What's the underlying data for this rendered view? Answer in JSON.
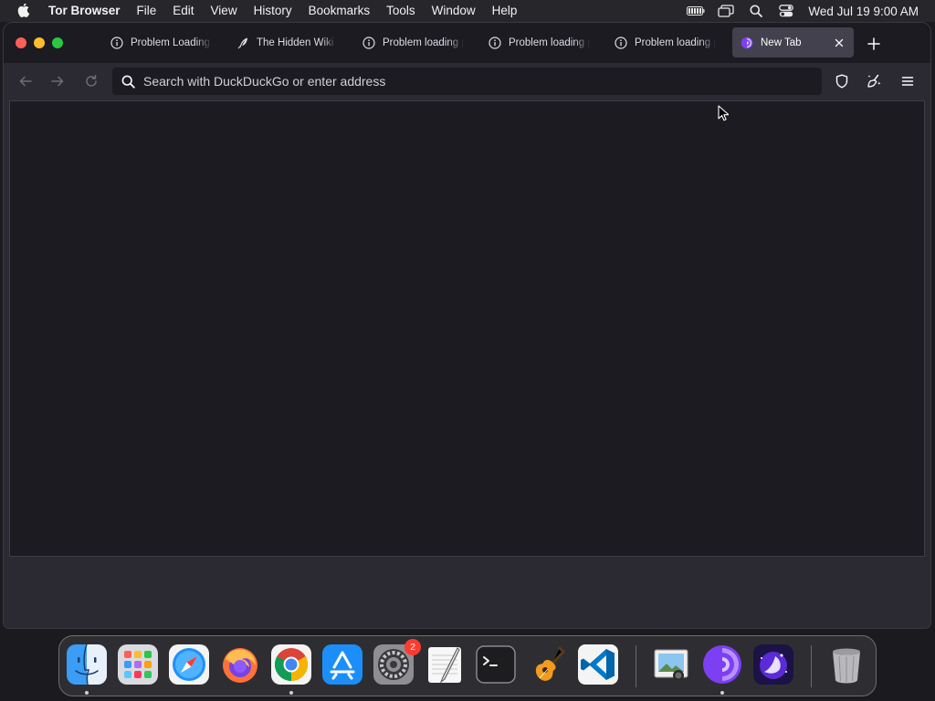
{
  "menubar": {
    "app_name": "Tor Browser",
    "items": [
      "File",
      "Edit",
      "View",
      "History",
      "Bookmarks",
      "Tools",
      "Window",
      "Help"
    ],
    "clock": "Wed Jul 19  9:00 AM"
  },
  "tabs": [
    {
      "label": "Problem Loading Page",
      "icon": "info-icon",
      "active": false
    },
    {
      "label": "The Hidden Wiki",
      "icon": "feather-icon",
      "active": false
    },
    {
      "label": "Problem loading page",
      "icon": "info-icon",
      "active": false
    },
    {
      "label": "Problem loading page",
      "icon": "info-icon",
      "active": false
    },
    {
      "label": "Problem loading page",
      "icon": "info-icon",
      "active": false
    },
    {
      "label": "New Tab",
      "icon": "tor-onion-icon",
      "active": true
    }
  ],
  "urlbar": {
    "placeholder": "Search with DuckDuckGo or enter address",
    "value": ""
  },
  "dock": {
    "apps": [
      {
        "name": "Finder",
        "running": true
      },
      {
        "name": "Launchpad",
        "running": false
      },
      {
        "name": "Safari",
        "running": false
      },
      {
        "name": "Firefox",
        "running": false
      },
      {
        "name": "Google Chrome",
        "running": true
      },
      {
        "name": "App Store",
        "running": false
      },
      {
        "name": "System Settings",
        "running": false,
        "badge": "2"
      },
      {
        "name": "TextEdit",
        "running": false
      },
      {
        "name": "Terminal",
        "running": false
      },
      {
        "name": "GarageBand",
        "running": false
      },
      {
        "name": "Visual Studio Code",
        "running": false
      },
      {
        "name": "Preview",
        "running": false
      },
      {
        "name": "Tor Browser",
        "running": true
      },
      {
        "name": "Tor Browser Alpha",
        "running": false
      },
      {
        "name": "Trash",
        "running": false
      }
    ]
  },
  "colors": {
    "menubar_bg": "#27262b",
    "tabstrip_bg": "#1c1b22",
    "toolbar_bg": "#2b2a33",
    "active_tab_bg": "#42414d",
    "tor_purple": "#7d3ff2"
  }
}
